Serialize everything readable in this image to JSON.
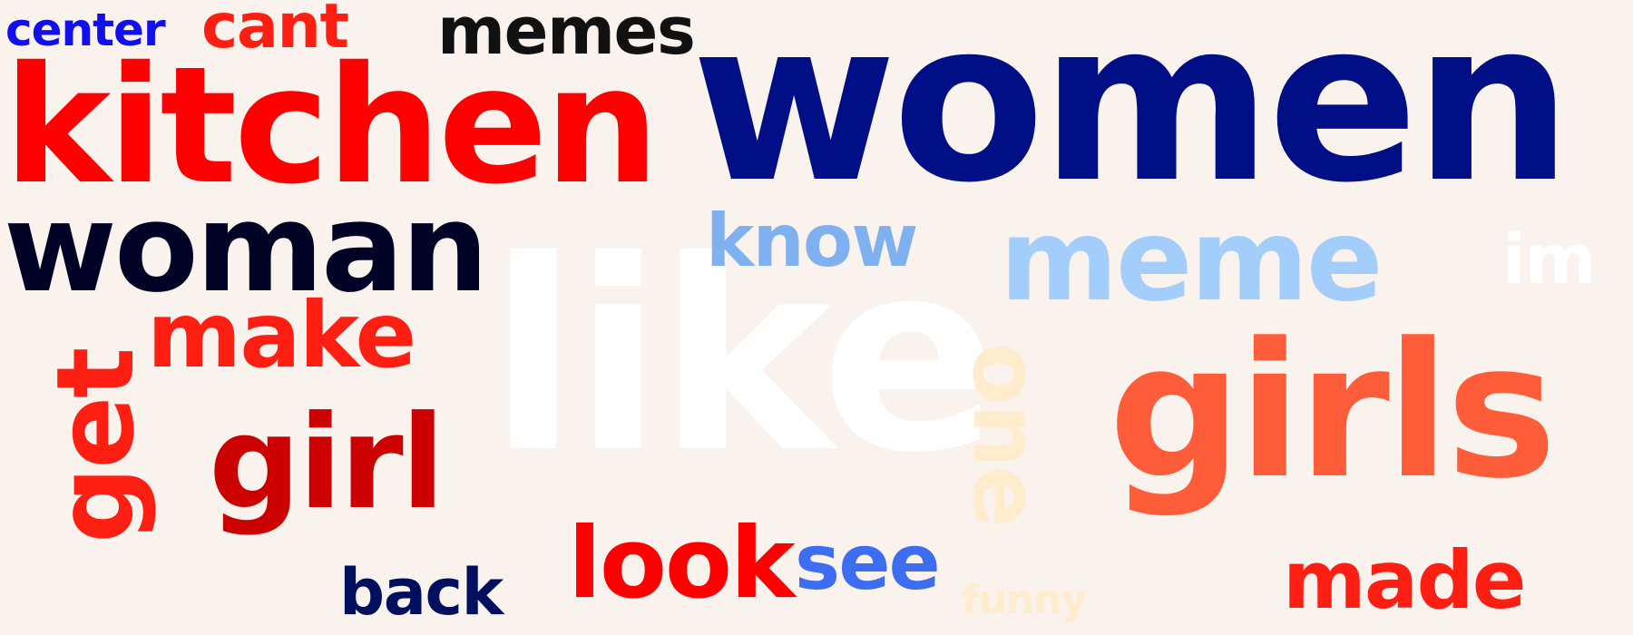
{
  "words": [
    {
      "id": "women",
      "text": "women",
      "color": "#000f85"
    },
    {
      "id": "like",
      "text": "like",
      "color": "#ffffff"
    },
    {
      "id": "kitchen",
      "text": "kitchen",
      "color": "#ff0000"
    },
    {
      "id": "girls",
      "text": "girls",
      "color": "#ff5c39"
    },
    {
      "id": "woman",
      "text": "woman",
      "color": "#000326"
    },
    {
      "id": "meme",
      "text": "meme",
      "color": "#a3cdfa"
    },
    {
      "id": "get",
      "text": "get",
      "color": "#ff1f12"
    },
    {
      "id": "girl",
      "text": "girl",
      "color": "#cc0000"
    },
    {
      "id": "make",
      "text": "make",
      "color": "#ff1f12"
    },
    {
      "id": "one",
      "text": "one",
      "color": "#ffeccd"
    },
    {
      "id": "look",
      "text": "look",
      "color": "#ff0000"
    },
    {
      "id": "memes",
      "text": "memes",
      "color": "#111111"
    },
    {
      "id": "know",
      "text": "know",
      "color": "#7fb1f0"
    },
    {
      "id": "cant",
      "text": "cant",
      "color": "#ff1f12"
    },
    {
      "id": "see",
      "text": "see",
      "color": "#3d6ef2"
    },
    {
      "id": "made",
      "text": "made",
      "color": "#ff1f12"
    },
    {
      "id": "center",
      "text": "center",
      "color": "#1010ee"
    },
    {
      "id": "back",
      "text": "back",
      "color": "#000f5e"
    },
    {
      "id": "im",
      "text": "im",
      "color": "#ffffff"
    },
    {
      "id": "funny",
      "text": "funny",
      "color": "#ffeccd"
    }
  ]
}
